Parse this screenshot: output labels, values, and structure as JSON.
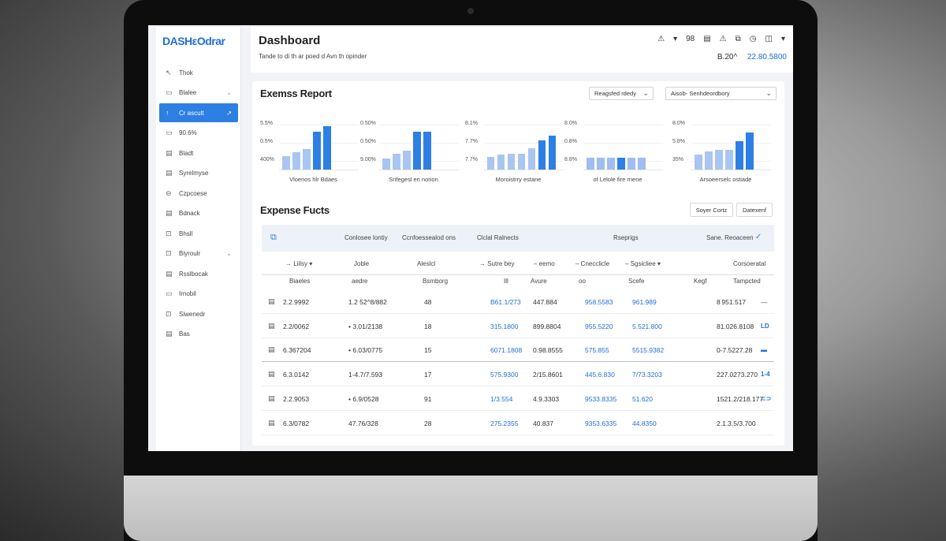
{
  "app": {
    "logo": "DASHεOdrar",
    "title": "Dashboard",
    "subtitle": "Tande to di th ar poed d Avn th opinder",
    "header_icons": [
      "warning-icon",
      "chevron-down-icon",
      "grid-icon",
      "calendar-icon",
      "alert-icon",
      "image-icon",
      "clock-icon",
      "camera-icon",
      "dropdown-icon"
    ],
    "header_icon_glyphs": [
      "⚠",
      "▾",
      "98",
      "▤",
      "⚠",
      "⧉",
      "◷",
      "◫",
      "▾"
    ],
    "stat_left": "B.20^",
    "stat_right": "22.80.5800"
  },
  "sidebar": {
    "items": [
      {
        "label": "Thok",
        "glyph": "↖"
      },
      {
        "label": "Blalee",
        "glyph": "▭",
        "chevron": "⌄"
      },
      {
        "label": "Cr ascult",
        "glyph": "↑",
        "active": true,
        "chevron": "↗"
      },
      {
        "label": "90.6%",
        "glyph": "▭"
      },
      {
        "label": "Bladt",
        "glyph": "▤"
      },
      {
        "label": "Syrelmyse",
        "glyph": "▤"
      },
      {
        "label": "Czpcoese",
        "glyph": "⊖"
      },
      {
        "label": "Bdnack",
        "glyph": "▤"
      },
      {
        "label": "Bhsll",
        "glyph": "⊡"
      },
      {
        "label": "Biyroulr",
        "glyph": "⊡",
        "chevron": "⌄"
      },
      {
        "label": "Rsslbocak",
        "glyph": "▤"
      },
      {
        "label": "Irnobil",
        "glyph": "▭"
      },
      {
        "label": "Siwenedr",
        "glyph": "⊡"
      },
      {
        "label": "Bas",
        "glyph": "▤"
      }
    ]
  },
  "report": {
    "title": "Exemss Report",
    "select1": "Reagsfed rdedy",
    "select2": "Aisob- Senhdeordbory",
    "charts": [
      {
        "ticks": [
          "5.5%",
          "0.5%",
          "400%"
        ],
        "label": "Vloenos hlr Bdaes",
        "values": [
          0.27,
          0.35,
          0.42,
          0.78,
          0.88
        ]
      },
      {
        "ticks": [
          "0.50%",
          "0.50%",
          "9.00%"
        ],
        "label": "Srifegesl en norion",
        "values": [
          0.22,
          0.32,
          0.38,
          0.77,
          0.77
        ]
      },
      {
        "ticks": [
          "8.1%",
          "7.7%",
          "7.7%"
        ],
        "label": "Moroistrry estane",
        "values": [
          0.25,
          0.3,
          0.32,
          0.32,
          0.43,
          0.6,
          0.7
        ]
      },
      {
        "ticks": [
          "8.0%",
          "0.8%",
          "8.8%"
        ],
        "label": "of Lelole fire rnene",
        "values": [
          0.24,
          0.24,
          0.24,
          0.24,
          0.24,
          0.24
        ]
      },
      {
        "ticks": [
          "8.0%",
          "5.8%",
          "35%"
        ],
        "label": "Arsoeerselc ostiade",
        "values": [
          0.3,
          0.37,
          0.4,
          0.4,
          0.58,
          0.75
        ]
      }
    ]
  },
  "funds": {
    "title": "Expense Fucts",
    "btn1": "Soyer Cortz",
    "btn2": "Datexenf",
    "banner": {
      "c1": "Conlosee lontiy",
      "c2": "Ccnfoessealod ons",
      "c3": "Clclal Ralnects",
      "c4": "Rseprigs",
      "c5": "Sane. Reoaceen"
    },
    "header1": [
      "→ Liilsy ▾",
      "Joble",
      "Aleslcl",
      "→ Sutre bey",
      "– eemo",
      "– Cnecclicle",
      "– Sgsicliee ▾",
      "Corsoeratal"
    ],
    "header2": [
      "Biaeles",
      "aedre",
      "Bsmborg",
      "Ill",
      "Avure",
      "oo",
      "Scefe",
      "Kegf",
      "Tampcted"
    ],
    "rows": [
      {
        "c1": "2.2.9992",
        "c2": "1.2 52^8/882",
        "c3": "48",
        "c4": "B61.1/273",
        "c5": "447.884",
        "c6": "958.5583",
        "c7": "961.989",
        "c8": "8 951.517",
        "end": "—"
      },
      {
        "c1": "2.2/0062",
        "c2": "• 3.01/2138",
        "c3": "18",
        "c4": "315.1800",
        "c5": "899.8804",
        "c6": "955.5220",
        "c7": "5.521.800",
        "c8": "81.026.8108",
        "end": "LD"
      },
      {
        "c1": "6.367204",
        "c2": "• 6.03/0775",
        "c3": "15",
        "c4": "6071.1808",
        "c5": "0.98.8555",
        "c6": "575.855",
        "c7": "5515.9382",
        "c8": "0-7.5227.28",
        "end": "▬"
      },
      {
        "c1": "6.3.0142",
        "c2": "1-4.7/7.593",
        "c3": "17",
        "c4": "575.9300",
        "c5": "2/15.8601",
        "c6": "445.6.830",
        "c7": "7/73.3203",
        "c8": "227.0273.270",
        "end": "1-4"
      },
      {
        "c1": "2.2.9053",
        "c2": "• 6.9/0528",
        "c3": "91",
        "c4": "1/3.554",
        "c5": "4.9.3303",
        "c6": "9533.8335",
        "c7": "51.620",
        "c8": "1521.2/218.177",
        "end": "⊂⊃"
      },
      {
        "c1": "6.3/0782",
        "c2": "47.76/328",
        "c3": "28",
        "c4": "275.2355",
        "c5": "40.837",
        "c6": "9353.6335",
        "c7": "44.8350",
        "c8": "2.1.3.5/3.700",
        "end": ""
      }
    ]
  }
}
